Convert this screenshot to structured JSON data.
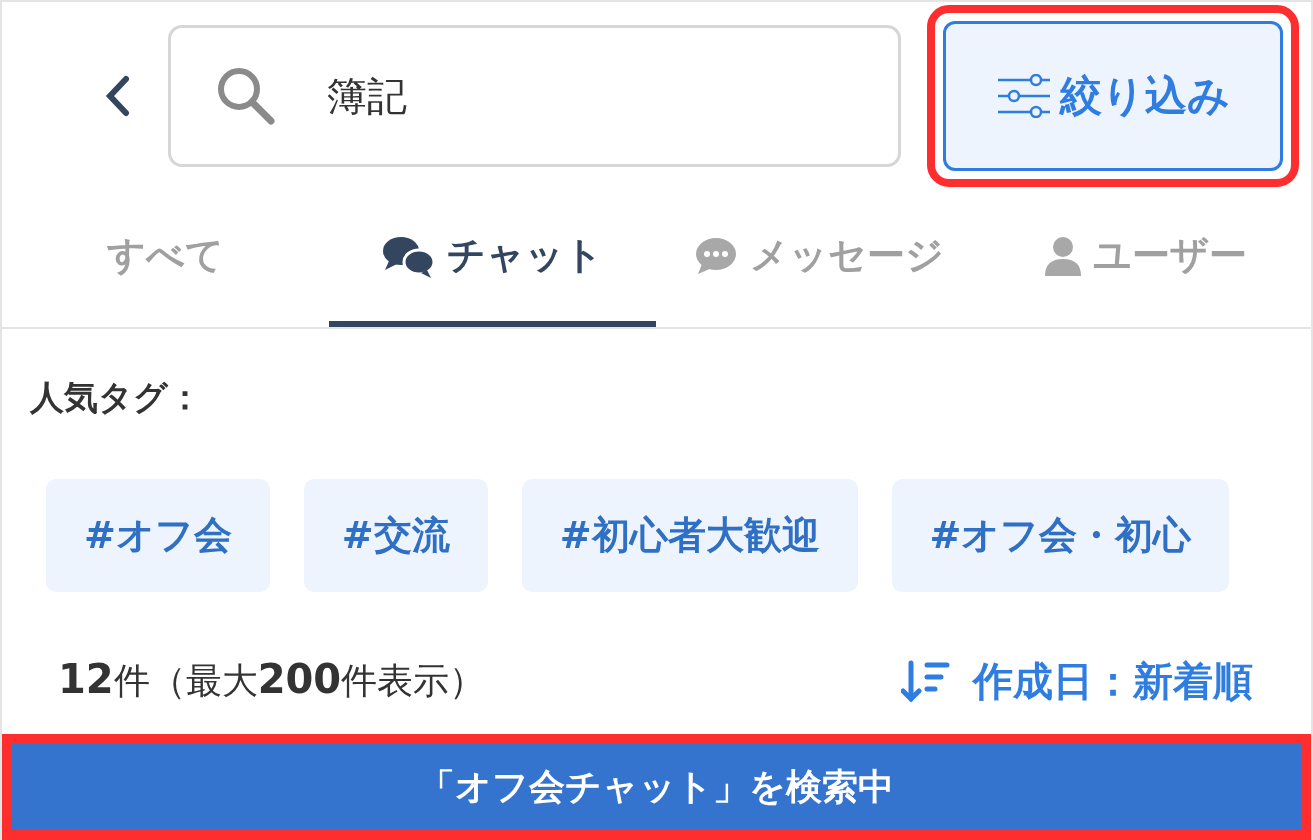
{
  "search": {
    "value": "簿記"
  },
  "filter_button": {
    "label": "絞り込み",
    "highlighted": true
  },
  "tabs": [
    {
      "label": "すべて",
      "kind": "plain",
      "selected": false
    },
    {
      "label": "チャット",
      "kind": "chat",
      "selected": true
    },
    {
      "label": "メッセージ",
      "kind": "message",
      "selected": false
    },
    {
      "label": "ユーザー",
      "kind": "user",
      "selected": false
    }
  ],
  "popular_tags": {
    "title": "人気タグ：",
    "tags": [
      "#オフ会",
      "#交流",
      "#初心者大歓迎",
      "#オフ会・初心"
    ]
  },
  "result_count": "**12**件（最大**200**件表示）",
  "sort": {
    "label": "作成日：新着順"
  },
  "status_banner": {
    "text": "「オフ会チャット」を検索中",
    "highlighted": true
  }
}
